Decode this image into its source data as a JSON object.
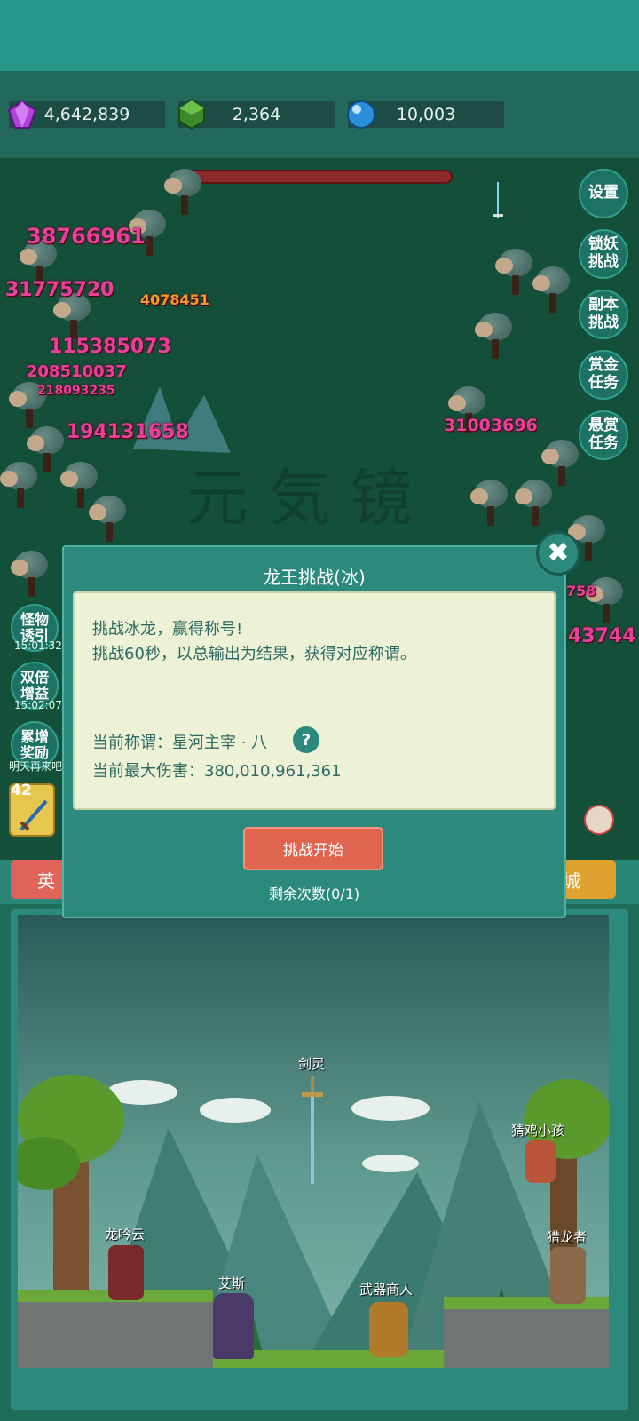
{
  "resources": [
    {
      "icon": "purple-gem-icon",
      "value": "4,642,839"
    },
    {
      "icon": "green-gem-icon",
      "value": "2,364"
    },
    {
      "icon": "blue-orb-icon",
      "value": "10,003"
    }
  ],
  "side_buttons": [
    {
      "name": "settings",
      "label": "设置"
    },
    {
      "name": "lock-demon-challenge",
      "label": "锁妖\n挑战"
    },
    {
      "name": "dungeon-challenge",
      "label": "副本\n挑战"
    },
    {
      "name": "bounty-task",
      "label": "赏金\n任务"
    },
    {
      "name": "reward-task",
      "label": "悬赏\n任务"
    }
  ],
  "left_buttons": [
    {
      "name": "monster-lure",
      "label": "怪物\n诱引",
      "timer": "15:01:32"
    },
    {
      "name": "double-boost",
      "label": "双倍\n增益",
      "timer": "15:02:07"
    },
    {
      "name": "accumulate-reward",
      "label": "累增\n奖励",
      "timer": "明天再来吧"
    }
  ],
  "damage_numbers": {
    "d1": "38766961",
    "d2": "31775720",
    "d3": "4078451",
    "d4": "115385073",
    "d5": "208510037",
    "d6": "218093235",
    "d7": "194131658",
    "d8": "31003696",
    "d9": "43744",
    "d10": "758"
  },
  "watermark": "元 気 镜",
  "skill_level": "42",
  "tabs": {
    "left": "英",
    "right": "城"
  },
  "npcs": {
    "sword_spirit": "剑灵",
    "chicken_kid": "猜鸡小孩",
    "long_yinyun": "龙吟云",
    "dragon_hunter": "猎龙者",
    "ais": "艾斯",
    "weapon_merchant": "武器商人"
  },
  "modal": {
    "title": "龙王挑战(冰)",
    "close_label": "✖",
    "line1": "挑战冰龙，赢得称号!",
    "line2": "挑战60秒，以总输出为结果，获得对应称谓。",
    "current_title": "当前称谓：星河主宰 · 八",
    "help": "?",
    "max_damage": "当前最大伤害：380,010,961,361",
    "start_button": "挑战开始",
    "remaining": "剩余次数(0/1)"
  },
  "colors": {
    "top_bar": "#279587",
    "battle_bg": "#144f39",
    "modal_bg": "#2c8a7d",
    "modal_body": "#edf2d6",
    "start_button": "#e0654f",
    "damage_pink": "#e8409a"
  }
}
